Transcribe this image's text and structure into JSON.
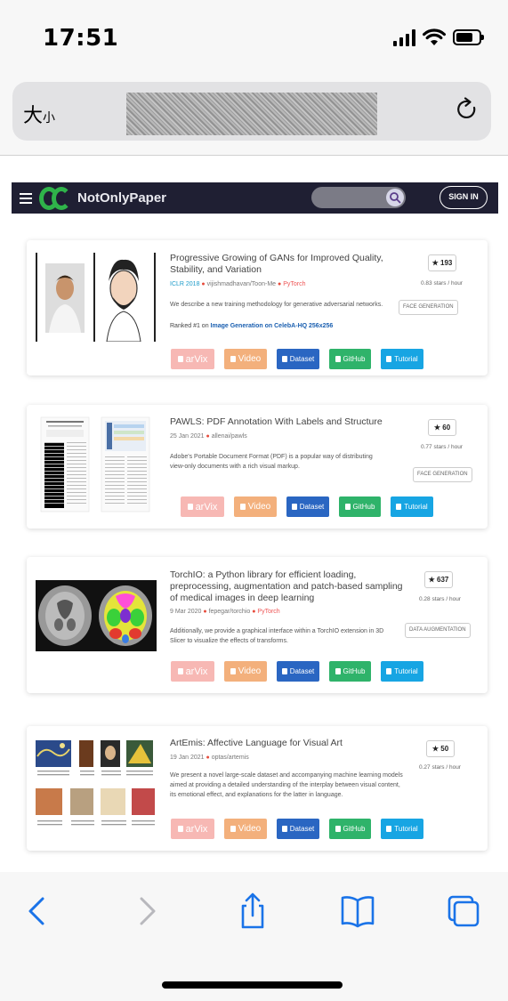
{
  "status": {
    "time": "17:51"
  },
  "browser": {
    "text_size_big": "大",
    "text_size_small": "小"
  },
  "site": {
    "brand": "NotOnlyPaper",
    "signin": "SIGN IN"
  },
  "papers": [
    {
      "title": "Progressive Growing of GANs for Improved Quality, Stability, and Variation",
      "conference": "ICLR 2018",
      "repo": "vijishmadhavan/Toon-Me",
      "framework": "PyTorch",
      "description": "We describe a new training methodology for generative adversarial networks.",
      "rank_prefix": "Ranked #1 on",
      "rank_link": "Image Generation on CelebA-HQ 256x256",
      "stars": "193",
      "rate": "0.83 stars / hour",
      "tag": "FACE GENERATION"
    },
    {
      "title": "PAWLS: PDF Annotation With Labels and Structure",
      "date": "25 Jan 2021",
      "repo": "allenai/pawls",
      "description": "Adobe's Portable Document Format (PDF) is a popular way of distributing view-only documents with a rich visual markup.",
      "stars": "60",
      "rate": "0.77 stars / hour",
      "tag": "FACE GENERATION"
    },
    {
      "title": "TorchIO: a Python library for efficient loading, preprocessing, augmentation and patch-based sampling of medical images in deep learning",
      "date": "9 Mar 2020",
      "repo": "fepegar/torchio",
      "framework": "PyTorch",
      "description": "Additionally, we provide a graphical interface within a TorchIO extension in 3D Slicer to visualize the effects of transforms.",
      "stars": "637",
      "rate": "0.28 stars / hour",
      "tag": "DATA AUGMENTATION"
    },
    {
      "title": "ArtEmis: Affective Language for Visual Art",
      "date": "19 Jan 2021",
      "repo": "optas/artemis",
      "description": "We present a novel large-scale dataset and accompanying machine learning models aimed at providing a detailed understanding of the interplay between visual content, its emotional effect, and explanations for the latter in language.",
      "stars": "50",
      "rate": "0.27 stars / hour"
    }
  ],
  "buttons": {
    "arxiv": "arVix",
    "video": "Video",
    "dataset": "Dataset",
    "github": "GitHub",
    "tutorial": "Tutorial"
  },
  "colors": {
    "navbar": "#1f1f33",
    "brand_green": "#2fb34a",
    "arxiv": "#f7b8b4",
    "video": "#f3b07c",
    "dataset": "#2a66c2",
    "github": "#2fb36a",
    "tutorial": "#17a5e3",
    "ios_blue": "#1a73e8"
  },
  "icons": [
    "signal-icon",
    "wifi-icon",
    "battery-icon",
    "reload-icon",
    "menu-icon",
    "search-icon",
    "star-icon",
    "back-icon",
    "forward-icon",
    "share-icon",
    "bookmarks-icon",
    "tabs-icon"
  ]
}
